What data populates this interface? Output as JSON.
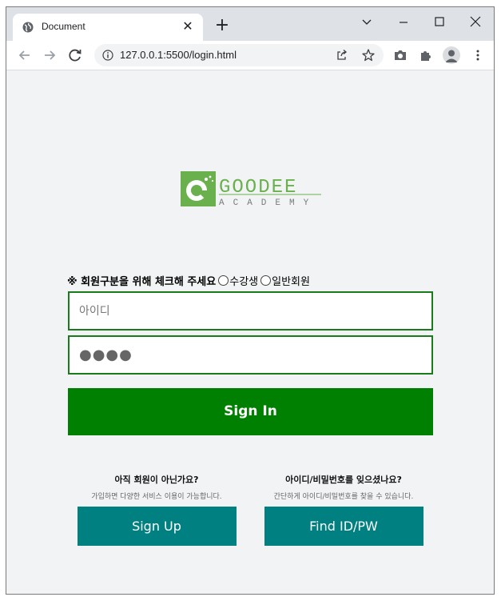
{
  "browser": {
    "tab_title": "Document",
    "tab_close": "✕",
    "new_tab": "+",
    "url": "127.0.0.1:5500/login.html",
    "window_controls": [
      "⌄",
      "—",
      "☐",
      "✕"
    ]
  },
  "logo": {
    "brand": "GOODEE",
    "tagline": "ACADEMY",
    "color": "#6ab04c"
  },
  "login": {
    "notice_mark": "※",
    "notice_text": "회원구분을 위해 체크해 주세요",
    "option_student": "수강생",
    "option_general": "일반회원",
    "id_placeholder": "아이디",
    "password_value": "●●●●",
    "signin_label": "Sign In"
  },
  "signup": {
    "question": "아직 회원이 아닌가요?",
    "description": "가입하면 다양한 서비스 이용이 가능합니다.",
    "button": "Sign Up"
  },
  "find": {
    "question": "아이디/비밀번호를 잊으셨나요?",
    "description": "간단하게 아이디/비밀번호를 찾을 수 있습니다.",
    "button": "Find ID/PW"
  },
  "colors": {
    "primary_green": "#008000",
    "border_green": "#1b7a1b",
    "teal": "#008080"
  }
}
